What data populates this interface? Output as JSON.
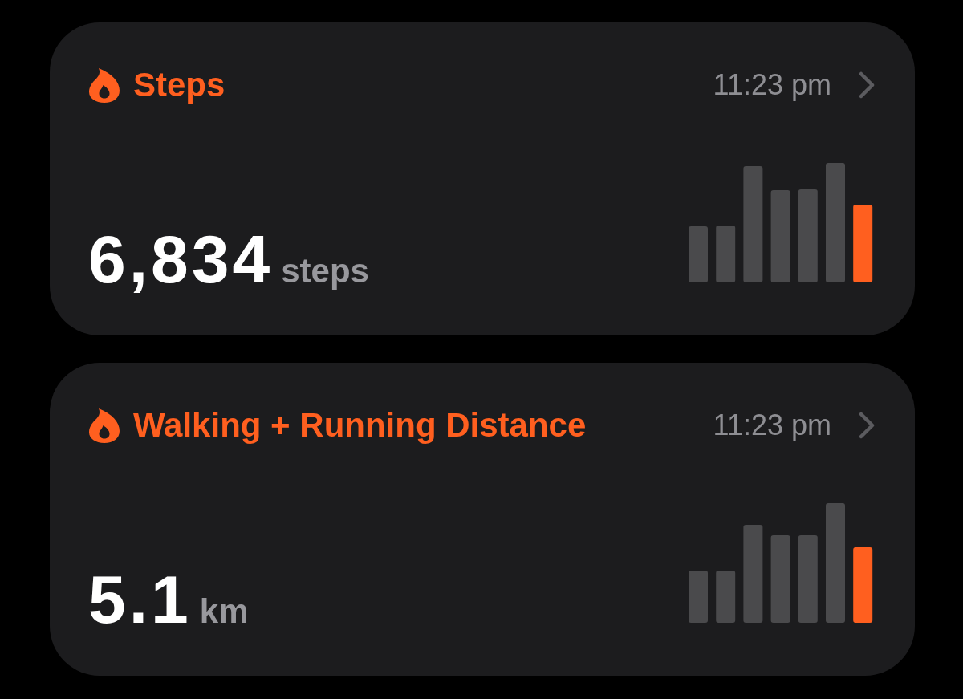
{
  "cards": [
    {
      "title": "Steps",
      "time": "11:23 pm",
      "value": "6,834",
      "unit": "steps"
    },
    {
      "title": "Walking + Running Distance",
      "time": "11:23 pm",
      "value": "5.1",
      "unit": "km"
    }
  ]
}
